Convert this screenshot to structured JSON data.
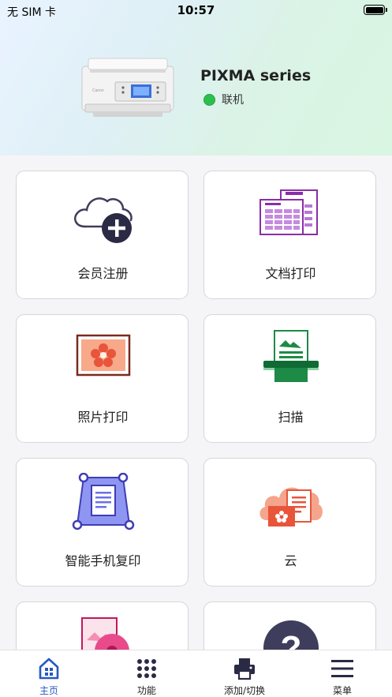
{
  "status_bar": {
    "carrier": "无 SIM 卡",
    "time": "10:57"
  },
  "printer": {
    "name": "PIXMA series",
    "status": "联机",
    "status_color": "#2dbf4d"
  },
  "features": [
    {
      "label": "会员注册",
      "icon": "cloud-add-icon"
    },
    {
      "label": "文档打印",
      "icon": "document-print-icon"
    },
    {
      "label": "照片打印",
      "icon": "photo-print-icon"
    },
    {
      "label": "扫描",
      "icon": "scan-icon"
    },
    {
      "label": "智能手机复印",
      "icon": "smartphone-copy-icon"
    },
    {
      "label": "云",
      "icon": "cloud-icon"
    },
    {
      "label": "",
      "icon": "quick-menu-icon"
    },
    {
      "label": "",
      "icon": "help-icon"
    }
  ],
  "tabs": [
    {
      "label": "主页",
      "icon": "home-icon",
      "active": true
    },
    {
      "label": "功能",
      "icon": "grid-dots-icon",
      "active": false
    },
    {
      "label": "添加/切换",
      "icon": "printer-icon",
      "active": false
    },
    {
      "label": "菜单",
      "icon": "hamburger-menu-icon",
      "active": false
    }
  ],
  "colors": {
    "accent": "#2559c4",
    "document_purple": "#8a2ea6",
    "photo_orange": "#e8553a",
    "scan_green": "#1d8a46",
    "copy_blue": "#6a70e8",
    "help_dark": "#3f3d5c"
  }
}
